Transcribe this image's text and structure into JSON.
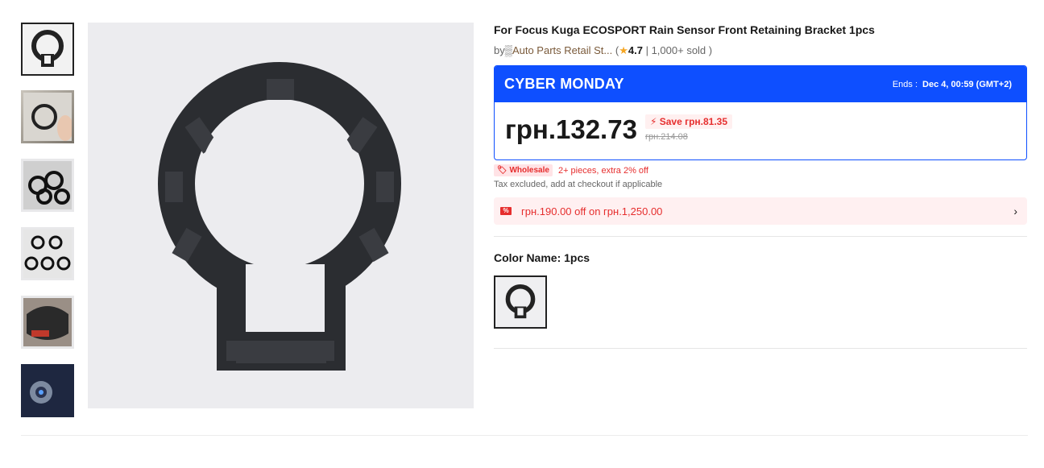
{
  "product": {
    "title": "For Focus Kuga ECOSPORT Rain Sensor Front Retaining Bracket 1pcs",
    "by_prefix": "by",
    "store_name": "Auto Parts Retail St...",
    "rating": "4.7",
    "sold": "1,000+ sold"
  },
  "promo": {
    "title": "CYBER MONDAY",
    "ends_label": "Ends :",
    "ends_time": "Dec 4, 00:59 (GMT+2)",
    "price": "грн.132.73",
    "save": "Save грн.81.35",
    "original_price": "грн.214.08",
    "accent_color": "#0e4fff"
  },
  "wholesale": {
    "badge": "Wholesale",
    "text": "2+ pieces, extra 2% off"
  },
  "tax_note": "Tax excluded, add at checkout if applicable",
  "coupon": {
    "text": "грн.190.00 off on грн.1,250.00"
  },
  "color": {
    "label": "Color Name: 1pcs"
  },
  "icons": {
    "rating": "star-icon",
    "save": "bolt-icon",
    "wholesale": "tag-icon",
    "coupon": "coupon-icon",
    "chevron": "chevron-right-icon"
  }
}
